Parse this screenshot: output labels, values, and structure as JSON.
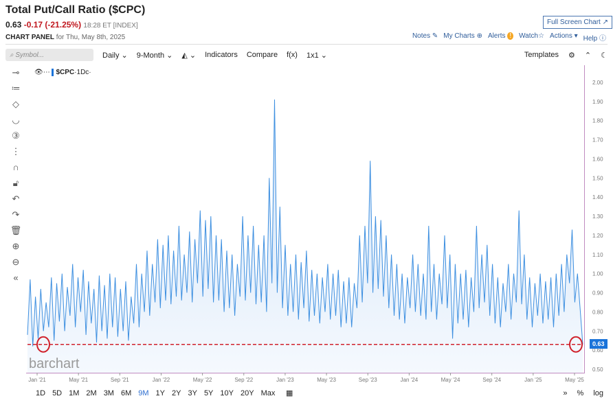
{
  "header": {
    "title": "Total Put/Call Ratio ($CPC)",
    "last": "0.63",
    "change": "-0.17 (-21.25%)",
    "time": "18:28 ET [INDEX]",
    "panel": "CHART PANEL",
    "panel_date": "for Thu, May 8th, 2025",
    "fullscreen": "Full Screen Chart ↗"
  },
  "links": {
    "notes": "Notes",
    "mycharts": "My Charts",
    "alerts": "Alerts",
    "watch": "Watch",
    "actions": "Actions ▾",
    "help": "Help"
  },
  "toolbar": {
    "search_placeholder": "Symbol...",
    "interval": "Daily ⌄",
    "period": "9-Month ⌄",
    "type": "⌄",
    "indicators": "Indicators",
    "compare": "Compare",
    "fx": "f(x)",
    "layout": "1x1 ⌄",
    "templates": "Templates"
  },
  "legend": {
    "symbol": "$CPC",
    "interval": "·1Dc·"
  },
  "logo": "barchart",
  "price_tag": "0.63",
  "range": [
    "1D",
    "5D",
    "1M",
    "2M",
    "3M",
    "6M",
    "9M",
    "1Y",
    "2Y",
    "3Y",
    "5Y",
    "10Y",
    "20Y",
    "Max"
  ],
  "range_active": "9M",
  "bottom_right": {
    "pct": "%",
    "log": "log"
  },
  "colors": {
    "line": "#3d8fe0",
    "accent": "#2e6fd0",
    "ref": "#d0202a"
  },
  "chart_data": {
    "type": "area",
    "title": "Total Put/Call Ratio ($CPC)",
    "ylim": [
      0.5,
      2.0
    ],
    "yticks": [
      "2.00",
      "1.90",
      "1.80",
      "1.70",
      "1.60",
      "1.50",
      "1.40",
      "1.30",
      "1.20",
      "1.10",
      "1.00",
      "0.90",
      "0.80",
      "0.70",
      "0.60",
      "0.50"
    ],
    "xticks": [
      "Jan '21",
      "May '21",
      "Sep '21",
      "Jan '22",
      "May '22",
      "Sep '22",
      "Jan '23",
      "May '23",
      "Sep '23",
      "Jan '24",
      "May '24",
      "Sep '24",
      "Jan '25",
      "May '25"
    ],
    "reference_line": 0.63,
    "values": [
      0.68,
      0.97,
      0.62,
      0.88,
      0.66,
      0.92,
      0.7,
      0.85,
      0.72,
      0.98,
      0.65,
      0.95,
      0.75,
      1.0,
      0.7,
      0.93,
      0.78,
      1.05,
      0.72,
      0.98,
      0.8,
      1.02,
      0.68,
      0.96,
      0.74,
      0.92,
      0.64,
      0.99,
      0.7,
      0.94,
      0.66,
      1.0,
      0.72,
      0.98,
      0.67,
      0.92,
      0.7,
      0.96,
      0.65,
      0.88,
      0.74,
      1.05,
      0.72,
      1.0,
      0.8,
      1.12,
      0.78,
      1.05,
      0.85,
      1.18,
      0.82,
      1.15,
      0.86,
      1.2,
      0.84,
      1.12,
      0.88,
      1.25,
      0.86,
      1.1,
      0.9,
      1.22,
      0.85,
      1.18,
      0.95,
      1.33,
      0.88,
      1.28,
      0.92,
      1.3,
      0.85,
      1.2,
      0.86,
      1.18,
      0.8,
      1.12,
      0.82,
      1.1,
      0.78,
      1.05,
      0.88,
      1.3,
      0.86,
      1.2,
      0.9,
      1.25,
      0.84,
      1.15,
      0.85,
      1.2,
      0.8,
      1.5,
      0.95,
      1.91,
      0.9,
      1.35,
      0.82,
      1.15,
      0.78,
      1.05,
      0.8,
      1.1,
      0.76,
      1.06,
      0.82,
      1.12,
      0.75,
      1.02,
      0.78,
      1.0,
      0.74,
      0.98,
      0.8,
      1.05,
      0.76,
      1.0,
      0.78,
      1.02,
      0.72,
      0.96,
      0.74,
      0.98,
      0.72,
      0.95,
      0.82,
      1.2,
      0.85,
      1.25,
      0.95,
      1.59,
      0.9,
      1.3,
      0.92,
      1.28,
      0.88,
      1.2,
      0.82,
      1.1,
      0.78,
      1.05,
      0.76,
      1.0,
      0.74,
      0.98,
      0.82,
      1.1,
      0.8,
      1.05,
      0.78,
      1.0,
      0.76,
      1.25,
      0.8,
      1.05,
      0.76,
      1.0,
      0.84,
      1.2,
      0.82,
      1.1,
      0.66,
      1.05,
      0.74,
      1.0,
      0.76,
      1.02,
      0.72,
      0.98,
      0.8,
      1.25,
      0.82,
      1.1,
      0.85,
      1.15,
      0.78,
      1.05,
      0.74,
      0.98,
      0.72,
      0.95,
      0.8,
      1.05,
      0.76,
      1.0,
      0.85,
      1.33,
      0.84,
      1.1,
      0.76,
      0.98,
      0.72,
      0.95,
      0.78,
      1.0,
      0.74,
      0.96,
      0.76,
      0.98,
      0.72,
      1.0,
      0.78,
      1.05,
      0.8,
      1.1,
      0.95,
      1.23,
      0.85,
      1.0,
      0.82,
      0.63
    ]
  }
}
